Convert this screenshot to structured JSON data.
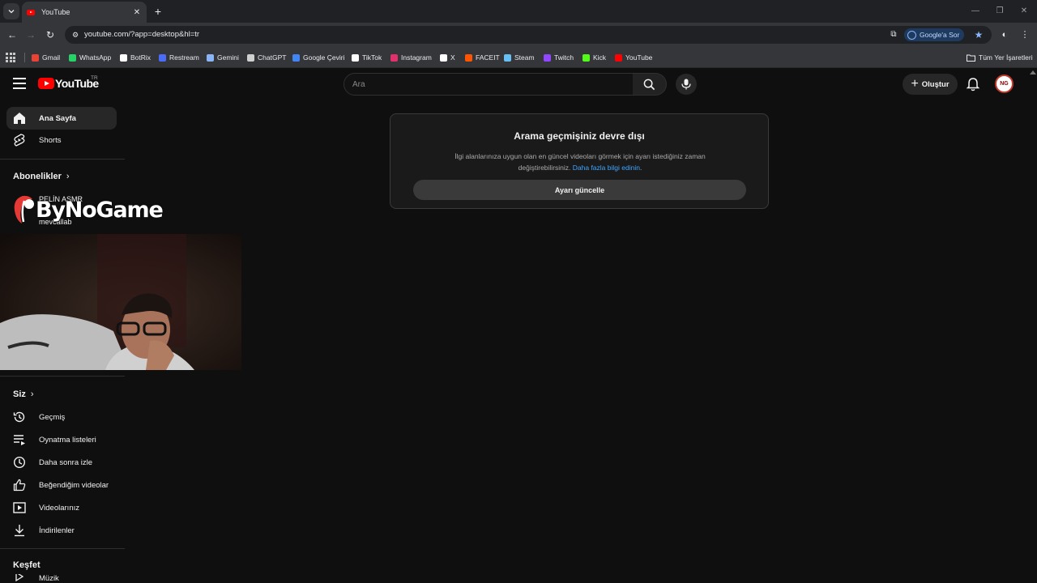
{
  "browser": {
    "tab_title": "YouTube",
    "url": "youtube.com/?app=desktop&hl=tr",
    "ask_google_label": "Google'a Sor",
    "bookmarks": [
      {
        "label": "Gmail",
        "color": "#ea4335"
      },
      {
        "label": "WhatsApp",
        "color": "#25d366"
      },
      {
        "label": "BotRix",
        "color": "#ffffff"
      },
      {
        "label": "Restream",
        "color": "#4a6cf7"
      },
      {
        "label": "Gemini",
        "color": "#8ab4f8"
      },
      {
        "label": "ChatGPT",
        "color": "#d0d0d0"
      },
      {
        "label": "Google Çeviri",
        "color": "#4285f4"
      },
      {
        "label": "TikTok",
        "color": "#ffffff"
      },
      {
        "label": "Instagram",
        "color": "#e1306c"
      },
      {
        "label": "X",
        "color": "#ffffff"
      },
      {
        "label": "FACEIT",
        "color": "#ff5500"
      },
      {
        "label": "Steam",
        "color": "#66c0f4"
      },
      {
        "label": "Twitch",
        "color": "#9146ff"
      },
      {
        "label": "Kick",
        "color": "#53fc18"
      },
      {
        "label": "YouTube",
        "color": "#ff0000"
      }
    ],
    "all_bookmarks_label": "Tüm Yer İşaretleri"
  },
  "youtube": {
    "logo_text": "YouTube",
    "country_code": "TR",
    "search_placeholder": "Ara",
    "create_label": "Oluştur",
    "avatar_text": "NG",
    "sidebar": {
      "home": "Ana Sayfa",
      "shorts": "Shorts",
      "subscriptions_heading": "Abonelikler",
      "subscriptions": [
        "PELİN ASMR",
        "mevcallab"
      ],
      "you_heading": "Siz",
      "you_items": [
        "Geçmiş",
        "Oynatma listeleri",
        "Daha sonra izle",
        "Beğendiğim videolar",
        "Videolarınız",
        "İndirilenler"
      ],
      "explore_heading": "Keşfet",
      "explore_items": [
        "Müzik"
      ]
    },
    "history_card": {
      "title": "Arama geçmişiniz devre dışı",
      "body": "İlgi alanlarınıza uygun olan en güncel videoları görmek için ayarı istediğiniz zaman değiştirebilirsiniz.",
      "link": "Daha fazla bilgi edinin",
      "link_suffix": ".",
      "button": "Ayarı güncelle"
    }
  },
  "overlay": {
    "streamer_logo_text": "ByNoGame"
  }
}
